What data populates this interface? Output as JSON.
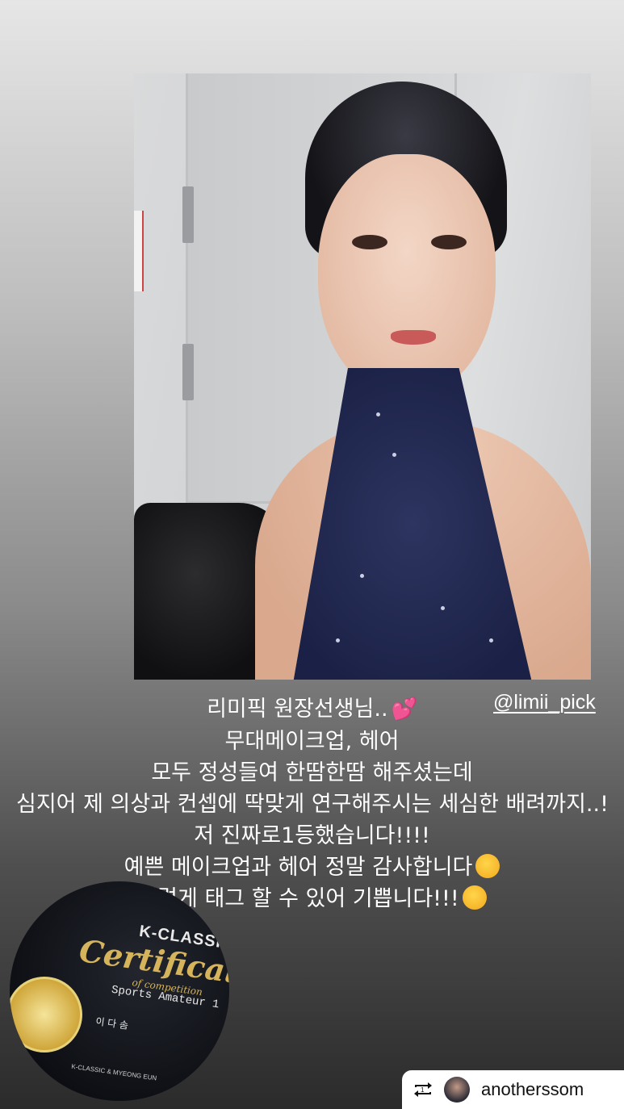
{
  "story": {
    "mention": "@limii_pick",
    "caption_lines": [
      "리미픽 원장선생님..",
      "무대메이크업, 헤어",
      "모두 정성들여 한땀한땀 해주셨는데",
      "심지어 제 의상과 컨셉에 딱맞게 연구해주시는 세심한 배려까지..!",
      "저 진짜로1등했습니다!!!!",
      "예쁜 메이크업과 헤어 정말 감사합니다",
      "이렇게 태그 할 수 있어 기쁩니다!!!"
    ],
    "emojis": [
      "two-hearts-emoji",
      "smiling-face-emoji",
      "star-struck-emoji"
    ],
    "certificate": {
      "brand": "K-CLASSIC",
      "title": "Certificate",
      "subtitle": "of competition",
      "category": "Sports Amateur 1",
      "name": "이 다 솜",
      "footer": "K-CLASSIC & MYEONG EUN"
    },
    "repost": {
      "username": "anotherssom"
    }
  },
  "colors": {
    "dress_navy": "#1b2146",
    "cert_gold": "#d6b45b",
    "heart_pink": "#ff4fa8"
  }
}
